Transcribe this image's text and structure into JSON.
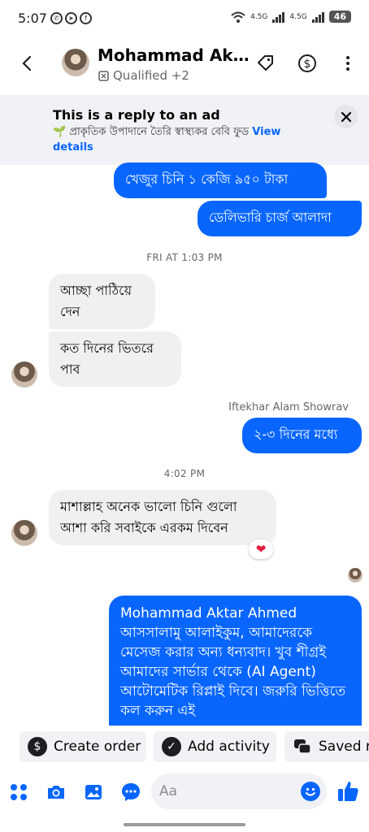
{
  "status_bar": {
    "time": "5:07",
    "net1": "4.5G",
    "net2": "4.5G",
    "battery": "46"
  },
  "header": {
    "name": "Mohammad Ak…",
    "subtitle": "Qualified +2"
  },
  "reply_banner": {
    "title": "This is a reply to an ad",
    "text": "🌱 প্রাকৃতিক উপাদানে তৈরি স্বাস্থ্যকর বেবি ফুড",
    "link": "View details"
  },
  "messages": {
    "out1": "খেজুর চিনি ১ কেজি ৯৫০ টাকা",
    "out2": "ডেলিভারি চার্জ আলাদা",
    "ts1": "FRI AT 1:03 PM",
    "in1": "আচ্ছা পাঠিয়ে দেন",
    "in2": "কত দিনের ভিতরে পাব",
    "sender": "Iftekhar Alam Showrav",
    "out3": "২-৩ দিনের মধ্যে",
    "ts2": "4:02 PM",
    "in3": "মাশাল্লাহ অনেক ভালো চিনি গুলো আশা করি সবাইকে এরকম দিবেন",
    "reaction": "❤",
    "out4": "Mohammad Aktar Ahmed আসসালামু আলাইকুম, আমাদেরকে মেসেজ করার অন্য ধন্যবাদ। খুব শীগ্রই আমাদের সার্ভার থেকে (AI Agent) আটোমেটিক রিপ্লাই দিবে। জরুরি ভিত্তিতে কল করুন এই"
  },
  "actions": {
    "create_order": "Create order",
    "add_activity": "Add activity",
    "saved_replies": "Saved re"
  },
  "composer": {
    "placeholder": "Aa"
  },
  "colors": {
    "accent": "#0866ff",
    "incoming_bubble": "#f0f0f0",
    "banner_bg": "#f0f2f5"
  }
}
